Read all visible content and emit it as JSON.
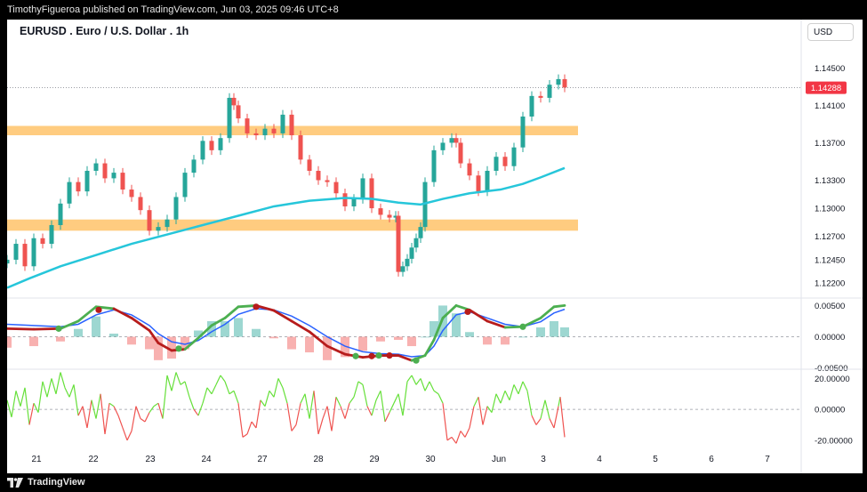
{
  "header": {
    "publisher_line": "TimothyFigueroa published on TradingView.com, Jun 03, 2025 09:46 UTC+8",
    "symbol_title": "EURUSD . Euro / U.S. Dollar . 1h",
    "currency_button": "USD"
  },
  "footer": {
    "brand": "TradingView"
  },
  "colors": {
    "up": "#26a69a",
    "down": "#ef5350",
    "zone": "#ffcc80",
    "ma": "#26c6da",
    "macd_fast": "#4caf50",
    "macd_slow": "#2962ff",
    "macd_red": "#b71c1c",
    "osc_up": "#66e03a",
    "osc_down": "#ef5350",
    "price_badge": "#f23645"
  },
  "chart_data": [
    {
      "type": "candlestick",
      "title": "EURUSD . Euro / U.S. Dollar . 1h",
      "x_ticks": [
        "21",
        "22",
        "23",
        "24",
        "27",
        "28",
        "29",
        "30",
        "Jun",
        "3",
        "4",
        "5",
        "6",
        "7"
      ],
      "y_ticks": [
        "1.14500",
        "1.14100",
        "1.13700",
        "1.13300",
        "1.13000",
        "1.12700",
        "1.12450",
        "1.12200"
      ],
      "y_tick_values": [
        1.145,
        1.141,
        1.137,
        1.133,
        1.13,
        1.127,
        1.1245,
        1.122
      ],
      "ylim": [
        1.1205,
        1.1475
      ],
      "last_price_label": "1.14288",
      "last_price": 1.14288,
      "zones": [
        {
          "from": 1.1378,
          "to": 1.1388
        },
        {
          "from": 1.1276,
          "to": 1.1288
        }
      ],
      "ma_series": [
        [
          0,
          1.1215
        ],
        [
          25,
          1.1225
        ],
        [
          60,
          1.1238
        ],
        [
          100,
          1.125
        ],
        [
          140,
          1.1262
        ],
        [
          180,
          1.1272
        ],
        [
          220,
          1.1282
        ],
        [
          260,
          1.1292
        ],
        [
          300,
          1.1302
        ],
        [
          340,
          1.1308
        ],
        [
          380,
          1.1311
        ],
        [
          410,
          1.131
        ],
        [
          440,
          1.1306
        ],
        [
          465,
          1.1304
        ],
        [
          490,
          1.131
        ],
        [
          520,
          1.1316
        ],
        [
          555,
          1.132
        ],
        [
          580,
          1.1326
        ],
        [
          600,
          1.1333
        ],
        [
          627,
          1.1343
        ]
      ],
      "close_series": [
        [
          0,
          1.1245
        ],
        [
          10,
          1.1262
        ],
        [
          20,
          1.1238
        ],
        [
          30,
          1.1268
        ],
        [
          40,
          1.1262
        ],
        [
          50,
          1.1282
        ],
        [
          60,
          1.1305
        ],
        [
          70,
          1.1328
        ],
        [
          80,
          1.1318
        ],
        [
          90,
          1.134
        ],
        [
          100,
          1.1348
        ],
        [
          110,
          1.1332
        ],
        [
          120,
          1.1338
        ],
        [
          130,
          1.132
        ],
        [
          140,
          1.1312
        ],
        [
          150,
          1.1298
        ],
        [
          160,
          1.1276
        ],
        [
          170,
          1.128
        ],
        [
          180,
          1.1288
        ],
        [
          190,
          1.1312
        ],
        [
          200,
          1.1338
        ],
        [
          210,
          1.1352
        ],
        [
          220,
          1.1372
        ],
        [
          230,
          1.1362
        ],
        [
          240,
          1.1375
        ],
        [
          250,
          1.1418
        ],
        [
          255,
          1.141
        ],
        [
          260,
          1.1396
        ],
        [
          270,
          1.138
        ],
        [
          280,
          1.1378
        ],
        [
          290,
          1.1385
        ],
        [
          300,
          1.138
        ],
        [
          310,
          1.14
        ],
        [
          320,
          1.1378
        ],
        [
          330,
          1.1352
        ],
        [
          340,
          1.134
        ],
        [
          350,
          1.133
        ],
        [
          360,
          1.1328
        ],
        [
          370,
          1.1316
        ],
        [
          380,
          1.1302
        ],
        [
          390,
          1.131
        ],
        [
          400,
          1.1332
        ],
        [
          410,
          1.13
        ],
        [
          420,
          1.1293
        ],
        [
          430,
          1.129
        ],
        [
          437,
          1.1292
        ],
        [
          440,
          1.1232
        ],
        [
          445,
          1.1238
        ],
        [
          450,
          1.1246
        ],
        [
          455,
          1.1258
        ],
        [
          460,
          1.1268
        ],
        [
          465,
          1.128
        ],
        [
          470,
          1.1328
        ],
        [
          480,
          1.1362
        ],
        [
          490,
          1.137
        ],
        [
          500,
          1.1375
        ],
        [
          505,
          1.137
        ],
        [
          510,
          1.1348
        ],
        [
          520,
          1.1335
        ],
        [
          530,
          1.1318
        ],
        [
          540,
          1.134
        ],
        [
          550,
          1.1355
        ],
        [
          560,
          1.1345
        ],
        [
          570,
          1.1365
        ],
        [
          580,
          1.1398
        ],
        [
          590,
          1.142
        ],
        [
          600,
          1.1418
        ],
        [
          610,
          1.1432
        ],
        [
          620,
          1.1438
        ],
        [
          627,
          1.1429
        ]
      ]
    },
    {
      "type": "line",
      "y_ticks": [
        "0.00500",
        "0.00000",
        "-0.00500"
      ],
      "y_tick_values": [
        0.005,
        0.0,
        -0.005
      ],
      "ylim": [
        -0.0052,
        0.0062
      ],
      "macd_series": [
        [
          0,
          0.0013
        ],
        [
          30,
          0.0012
        ],
        [
          60,
          0.0013
        ],
        [
          80,
          0.0025
        ],
        [
          100,
          0.0048
        ],
        [
          120,
          0.0045
        ],
        [
          140,
          0.003
        ],
        [
          160,
          0.001
        ],
        [
          170,
          -0.001
        ],
        [
          185,
          -0.0022
        ],
        [
          200,
          -0.002
        ],
        [
          215,
          -0.0002
        ],
        [
          230,
          0.0018
        ],
        [
          245,
          0.003
        ],
        [
          260,
          0.0048
        ],
        [
          280,
          0.005
        ],
        [
          300,
          0.0042
        ],
        [
          320,
          0.0025
        ],
        [
          340,
          0.0008
        ],
        [
          360,
          -0.0015
        ],
        [
          380,
          -0.0028
        ],
        [
          400,
          -0.0033
        ],
        [
          420,
          -0.003
        ],
        [
          440,
          -0.003
        ],
        [
          455,
          -0.0038
        ],
        [
          470,
          -0.003
        ],
        [
          480,
          -0.0005
        ],
        [
          490,
          0.003
        ],
        [
          505,
          0.005
        ],
        [
          520,
          0.0043
        ],
        [
          540,
          0.0025
        ],
        [
          560,
          0.0015
        ],
        [
          580,
          0.0016
        ],
        [
          600,
          0.003
        ],
        [
          615,
          0.0048
        ],
        [
          627,
          0.005
        ]
      ],
      "signal_series": [
        [
          0,
          0.002
        ],
        [
          30,
          0.0018
        ],
        [
          60,
          0.0016
        ],
        [
          80,
          0.002
        ],
        [
          100,
          0.0035
        ],
        [
          120,
          0.0043
        ],
        [
          140,
          0.0035
        ],
        [
          160,
          0.0018
        ],
        [
          170,
          0.0005
        ],
        [
          185,
          -0.0008
        ],
        [
          200,
          -0.0012
        ],
        [
          215,
          -0.0006
        ],
        [
          230,
          0.0008
        ],
        [
          245,
          0.002
        ],
        [
          260,
          0.0036
        ],
        [
          280,
          0.0045
        ],
        [
          300,
          0.0043
        ],
        [
          320,
          0.0033
        ],
        [
          340,
          0.0018
        ],
        [
          360,
          0.0
        ],
        [
          380,
          -0.0015
        ],
        [
          400,
          -0.0024
        ],
        [
          420,
          -0.0027
        ],
        [
          440,
          -0.0028
        ],
        [
          455,
          -0.0032
        ],
        [
          470,
          -0.003
        ],
        [
          480,
          -0.0015
        ],
        [
          490,
          0.001
        ],
        [
          505,
          0.0035
        ],
        [
          520,
          0.004
        ],
        [
          540,
          0.003
        ],
        [
          560,
          0.002
        ],
        [
          580,
          0.0016
        ],
        [
          600,
          0.0024
        ],
        [
          615,
          0.0038
        ],
        [
          627,
          0.0044
        ]
      ],
      "cross_markers": [
        [
          58,
          0.0013,
          "bull"
        ],
        [
          103,
          0.0043,
          "bear"
        ],
        [
          193,
          -0.0019,
          "bull"
        ],
        [
          280,
          0.0048,
          "bear"
        ],
        [
          392,
          -0.0031,
          "bull"
        ],
        [
          410,
          -0.0031,
          "bear"
        ],
        [
          418,
          -0.003,
          "bull"
        ],
        [
          430,
          -0.003,
          "bear"
        ],
        [
          460,
          -0.0038,
          "bull"
        ],
        [
          518,
          0.004,
          "bear"
        ],
        [
          580,
          0.0016,
          "bull"
        ]
      ]
    },
    {
      "type": "line",
      "y_ticks": [
        "20.00000",
        "0.00000",
        "-20.00000"
      ],
      "y_tick_values": [
        20,
        0,
        -20
      ],
      "ylim": [
        -27,
        26
      ],
      "oscillator_series": [
        [
          0,
          6
        ],
        [
          5,
          -5
        ],
        [
          10,
          12
        ],
        [
          15,
          2
        ],
        [
          20,
          14
        ],
        [
          25,
          -10
        ],
        [
          30,
          4
        ],
        [
          35,
          -2
        ],
        [
          40,
          18
        ],
        [
          45,
          8
        ],
        [
          50,
          20
        ],
        [
          55,
          10
        ],
        [
          60,
          24
        ],
        [
          65,
          14
        ],
        [
          70,
          8
        ],
        [
          75,
          16
        ],
        [
          80,
          -4
        ],
        [
          85,
          2
        ],
        [
          90,
          -12
        ],
        [
          95,
          6
        ],
        [
          100,
          -6
        ],
        [
          105,
          10
        ],
        [
          110,
          -16
        ],
        [
          115,
          4
        ],
        [
          120,
          2
        ],
        [
          125,
          -4
        ],
        [
          130,
          -12
        ],
        [
          135,
          -20
        ],
        [
          140,
          -14
        ],
        [
          145,
          2
        ],
        [
          150,
          -6
        ],
        [
          155,
          -8
        ],
        [
          160,
          -2
        ],
        [
          165,
          2
        ],
        [
          170,
          4
        ],
        [
          175,
          -6
        ],
        [
          180,
          22
        ],
        [
          185,
          12
        ],
        [
          190,
          24
        ],
        [
          195,
          16
        ],
        [
          200,
          18
        ],
        [
          205,
          8
        ],
        [
          210,
          0
        ],
        [
          215,
          -4
        ],
        [
          220,
          4
        ],
        [
          225,
          14
        ],
        [
          230,
          10
        ],
        [
          235,
          16
        ],
        [
          240,
          22
        ],
        [
          245,
          18
        ],
        [
          250,
          10
        ],
        [
          255,
          12
        ],
        [
          260,
          4
        ],
        [
          265,
          -18
        ],
        [
          270,
          -16
        ],
        [
          275,
          -8
        ],
        [
          280,
          -12
        ],
        [
          285,
          6
        ],
        [
          290,
          2
        ],
        [
          295,
          12
        ],
        [
          300,
          8
        ],
        [
          305,
          20
        ],
        [
          310,
          14
        ],
        [
          315,
          4
        ],
        [
          320,
          -14
        ],
        [
          325,
          -10
        ],
        [
          330,
          4
        ],
        [
          335,
          10
        ],
        [
          340,
          -6
        ],
        [
          345,
          12
        ],
        [
          350,
          -16
        ],
        [
          355,
          -6
        ],
        [
          360,
          2
        ],
        [
          365,
          -14
        ],
        [
          370,
          8
        ],
        [
          375,
          2
        ],
        [
          380,
          -6
        ],
        [
          385,
          4
        ],
        [
          390,
          8
        ],
        [
          395,
          18
        ],
        [
          400,
          16
        ],
        [
          405,
          2
        ],
        [
          410,
          -4
        ],
        [
          415,
          6
        ],
        [
          420,
          12
        ],
        [
          425,
          -8
        ],
        [
          430,
          -2
        ],
        [
          435,
          4
        ],
        [
          440,
          10
        ],
        [
          445,
          -4
        ],
        [
          450,
          18
        ],
        [
          455,
          22
        ],
        [
          460,
          16
        ],
        [
          465,
          20
        ],
        [
          470,
          12
        ],
        [
          475,
          18
        ],
        [
          480,
          12
        ],
        [
          485,
          10
        ],
        [
          490,
          4
        ],
        [
          495,
          -20
        ],
        [
          500,
          -18
        ],
        [
          505,
          -22
        ],
        [
          510,
          -14
        ],
        [
          515,
          -18
        ],
        [
          520,
          -12
        ],
        [
          525,
          2
        ],
        [
          530,
          8
        ],
        [
          535,
          -10
        ],
        [
          540,
          2
        ],
        [
          545,
          -2
        ],
        [
          550,
          10
        ],
        [
          555,
          4
        ],
        [
          560,
          12
        ],
        [
          565,
          6
        ],
        [
          570,
          16
        ],
        [
          575,
          10
        ],
        [
          580,
          18
        ],
        [
          585,
          12
        ],
        [
          590,
          -4
        ],
        [
          595,
          -10
        ],
        [
          600,
          -6
        ],
        [
          605,
          6
        ],
        [
          610,
          -6
        ],
        [
          615,
          -12
        ],
        [
          620,
          2
        ],
        [
          622,
          8
        ],
        [
          627,
          -18
        ]
      ]
    }
  ]
}
